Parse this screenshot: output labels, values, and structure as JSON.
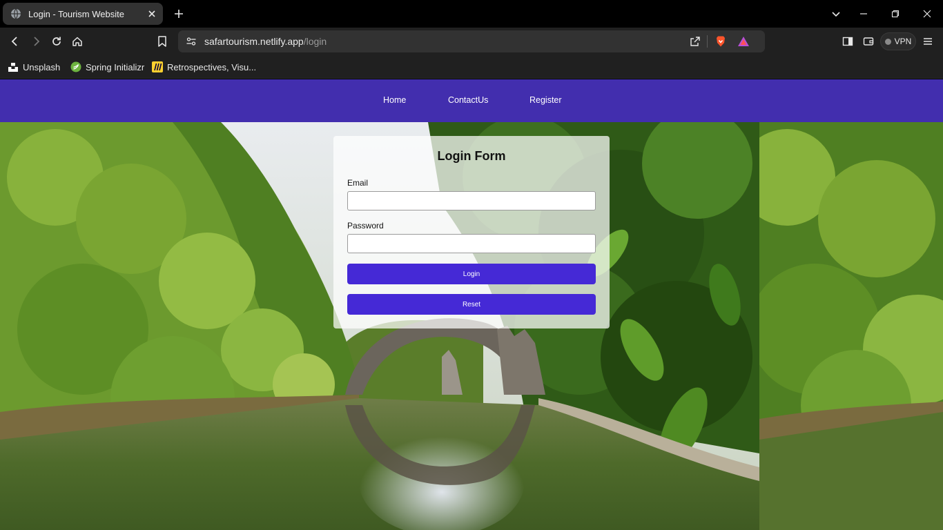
{
  "browser": {
    "tab": {
      "title": "Login - Tourism Website",
      "favicon": "globe-icon"
    },
    "address": {
      "host": "safartourism.netlify.app",
      "path": "/login"
    },
    "vpn_label": "VPN",
    "bookmarks": [
      {
        "label": "Unsplash",
        "icon": "unsplash-icon"
      },
      {
        "label": "Spring Initializr",
        "icon": "spring-icon"
      },
      {
        "label": "Retrospectives, Visu...",
        "icon": "miro-icon"
      }
    ]
  },
  "nav": {
    "links": [
      "Home",
      "ContactUs",
      "Register"
    ],
    "color": "#422eae"
  },
  "form": {
    "title": "Login Form",
    "email_label": "Email",
    "email_value": "",
    "password_label": "Password",
    "password_value": "",
    "login_button": "Login",
    "reset_button": "Reset",
    "button_color": "#4529d6"
  }
}
